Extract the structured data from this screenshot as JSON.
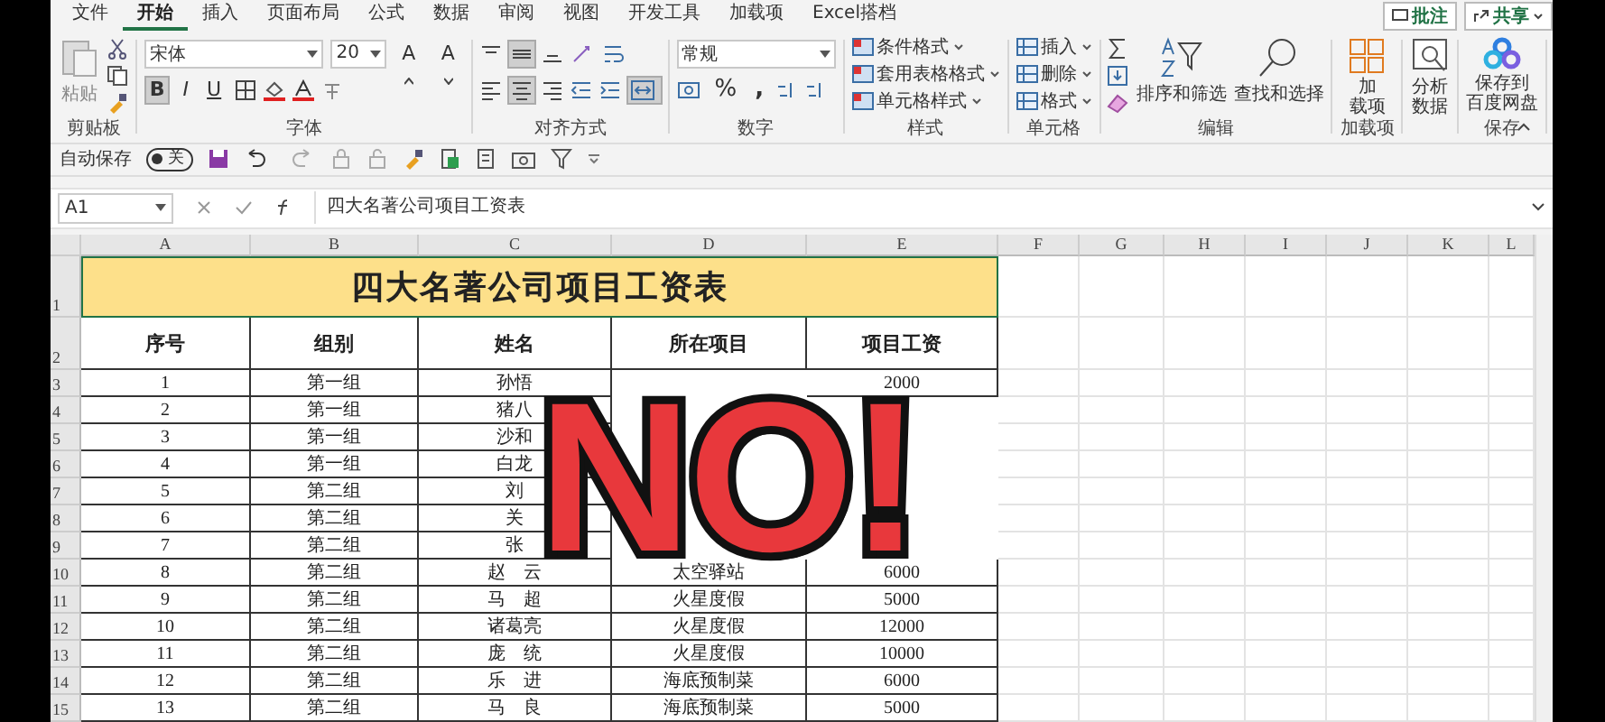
{
  "ribbon_tabs": [
    {
      "label": "文件",
      "selected": false
    },
    {
      "label": "开始",
      "selected": true
    },
    {
      "label": "插入",
      "selected": false
    },
    {
      "label": "页面布局",
      "selected": false
    },
    {
      "label": "公式",
      "selected": false
    },
    {
      "label": "数据",
      "selected": false
    },
    {
      "label": "审阅",
      "selected": false
    },
    {
      "label": "视图",
      "selected": false
    },
    {
      "label": "开发工具",
      "selected": false
    },
    {
      "label": "加载项",
      "selected": false
    },
    {
      "label": "Excel搭档",
      "selected": false
    }
  ],
  "comment_button": "批注",
  "share_button": "共享",
  "clipboard": {
    "paste": "粘贴",
    "group": "剪贴板"
  },
  "font": {
    "name": "宋体",
    "size": "20",
    "grow": "A",
    "shrink": "A",
    "bold": {
      "label": "B",
      "pressed": true
    },
    "italic": {
      "label": "I",
      "pressed": false
    },
    "underline": {
      "label": "U",
      "pressed": false
    },
    "group": "字体"
  },
  "alignment": {
    "center_pressed": true,
    "merge_pressed": true,
    "group": "对齐方式"
  },
  "number": {
    "format": "常规",
    "percent": "%",
    "comma": ",",
    "group": "数字"
  },
  "styles": {
    "items": [
      "条件格式",
      "套用表格格式",
      "单元格样式"
    ],
    "group": "样式"
  },
  "cells": {
    "items": [
      "插入",
      "删除",
      "格式"
    ],
    "group": "单元格"
  },
  "editing": {
    "sort": "排序和筛选",
    "find": "查找和选择",
    "group": "编辑"
  },
  "addins": {
    "button": [
      "加",
      "载项"
    ],
    "group": "加载项"
  },
  "analyze": [
    "分析",
    "数据"
  ],
  "baidu": {
    "button": [
      "保存到",
      "百度网盘"
    ],
    "group": "保存"
  },
  "qat": {
    "autosave_label": "自动保存",
    "autosave_on": false,
    "toggle_text": "关"
  },
  "formula_bar": {
    "name_box": "A1",
    "formula": "四大名著公司项目工资表"
  },
  "sheet": {
    "columns": [
      "A",
      "B",
      "C",
      "D",
      "E",
      "F",
      "G",
      "H",
      "I",
      "J",
      "K",
      "L"
    ],
    "title_row": "1",
    "title": "四大名著公司项目工资表",
    "header_row": "2",
    "headers": [
      "序号",
      "组别",
      "姓名",
      "所在项目",
      "项目工资"
    ],
    "rows": [
      {
        "number": "3",
        "cells": [
          "1",
          "第一组",
          "孙悟",
          null,
          "2000"
        ]
      },
      {
        "number": "4",
        "cells": [
          "2",
          "第一组",
          "猪八",
          null,
          null
        ]
      },
      {
        "number": "5",
        "cells": [
          "3",
          "第一组",
          "沙和",
          null,
          null
        ]
      },
      {
        "number": "6",
        "cells": [
          "4",
          "第一组",
          "白龙",
          null,
          null
        ]
      },
      {
        "number": "7",
        "cells": [
          "5",
          "第二组",
          "刘",
          null,
          null
        ]
      },
      {
        "number": "8",
        "cells": [
          "6",
          "第二组",
          "关",
          null,
          null
        ]
      },
      {
        "number": "9",
        "cells": [
          "7",
          "第二组",
          "张",
          null,
          null
        ]
      },
      {
        "number": "10",
        "cells": [
          "8",
          "第二组",
          "赵　云",
          "太空驿站",
          "6000"
        ]
      },
      {
        "number": "11",
        "cells": [
          "9",
          "第二组",
          "马　超",
          "火星度假",
          "5000"
        ]
      },
      {
        "number": "12",
        "cells": [
          "10",
          "第二组",
          "诸葛亮",
          "火星度假",
          "12000"
        ]
      },
      {
        "number": "13",
        "cells": [
          "11",
          "第二组",
          "庞　统",
          "火星度假",
          "10000"
        ]
      },
      {
        "number": "14",
        "cells": [
          "12",
          "第二组",
          "乐　进",
          "海底预制菜",
          "6000"
        ]
      },
      {
        "number": "15",
        "cells": [
          "13",
          "第二组",
          "马　良",
          "海底预制菜",
          "5000"
        ]
      }
    ]
  },
  "sticker": {
    "text": "NO!"
  }
}
